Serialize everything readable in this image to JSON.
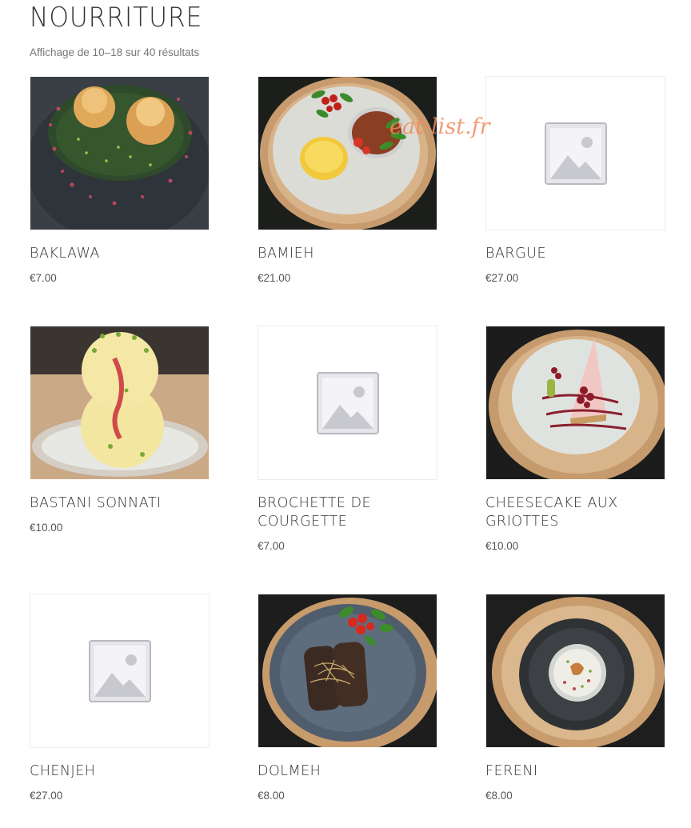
{
  "page": {
    "title": "NOURRITURE",
    "result_count": "Affichage de 10–18 sur 40 résultats",
    "watermark": "eat-list.fr"
  },
  "products": [
    {
      "name": "BAKLAWA",
      "price": "€7.00",
      "image": "baklawa-photo"
    },
    {
      "name": "BAMIEH",
      "price": "€21.00",
      "image": "bamieh-photo"
    },
    {
      "name": "BARGUE",
      "price": "€27.00",
      "image": "placeholder-icon"
    },
    {
      "name": "BASTANI SONNATI",
      "price": "€10.00",
      "image": "bastani-photo"
    },
    {
      "name": "BROCHETTE DE COURGETTE",
      "price": "€7.00",
      "image": "placeholder-icon"
    },
    {
      "name": "CHEESECAKE AUX GRIOTTES",
      "price": "€10.00",
      "image": "cheesecake-photo"
    },
    {
      "name": "CHENJEH",
      "price": "€27.00",
      "image": "placeholder-icon"
    },
    {
      "name": "DOLMEH",
      "price": "€8.00",
      "image": "dolmeh-photo"
    },
    {
      "name": "FERENI",
      "price": "€8.00",
      "image": "fereni-photo"
    }
  ]
}
